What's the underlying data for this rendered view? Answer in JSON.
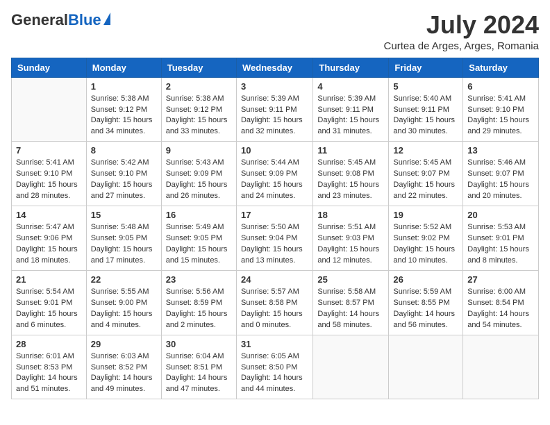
{
  "header": {
    "logo_general": "General",
    "logo_blue": "Blue",
    "month": "July 2024",
    "location": "Curtea de Arges, Arges, Romania"
  },
  "weekdays": [
    "Sunday",
    "Monday",
    "Tuesday",
    "Wednesday",
    "Thursday",
    "Friday",
    "Saturday"
  ],
  "weeks": [
    [
      {
        "day": "",
        "sunrise": "",
        "sunset": "",
        "daylight": ""
      },
      {
        "day": "1",
        "sunrise": "Sunrise: 5:38 AM",
        "sunset": "Sunset: 9:12 PM",
        "daylight": "Daylight: 15 hours and 34 minutes."
      },
      {
        "day": "2",
        "sunrise": "Sunrise: 5:38 AM",
        "sunset": "Sunset: 9:12 PM",
        "daylight": "Daylight: 15 hours and 33 minutes."
      },
      {
        "day": "3",
        "sunrise": "Sunrise: 5:39 AM",
        "sunset": "Sunset: 9:11 PM",
        "daylight": "Daylight: 15 hours and 32 minutes."
      },
      {
        "day": "4",
        "sunrise": "Sunrise: 5:39 AM",
        "sunset": "Sunset: 9:11 PM",
        "daylight": "Daylight: 15 hours and 31 minutes."
      },
      {
        "day": "5",
        "sunrise": "Sunrise: 5:40 AM",
        "sunset": "Sunset: 9:11 PM",
        "daylight": "Daylight: 15 hours and 30 minutes."
      },
      {
        "day": "6",
        "sunrise": "Sunrise: 5:41 AM",
        "sunset": "Sunset: 9:10 PM",
        "daylight": "Daylight: 15 hours and 29 minutes."
      }
    ],
    [
      {
        "day": "7",
        "sunrise": "Sunrise: 5:41 AM",
        "sunset": "Sunset: 9:10 PM",
        "daylight": "Daylight: 15 hours and 28 minutes."
      },
      {
        "day": "8",
        "sunrise": "Sunrise: 5:42 AM",
        "sunset": "Sunset: 9:10 PM",
        "daylight": "Daylight: 15 hours and 27 minutes."
      },
      {
        "day": "9",
        "sunrise": "Sunrise: 5:43 AM",
        "sunset": "Sunset: 9:09 PM",
        "daylight": "Daylight: 15 hours and 26 minutes."
      },
      {
        "day": "10",
        "sunrise": "Sunrise: 5:44 AM",
        "sunset": "Sunset: 9:09 PM",
        "daylight": "Daylight: 15 hours and 24 minutes."
      },
      {
        "day": "11",
        "sunrise": "Sunrise: 5:45 AM",
        "sunset": "Sunset: 9:08 PM",
        "daylight": "Daylight: 15 hours and 23 minutes."
      },
      {
        "day": "12",
        "sunrise": "Sunrise: 5:45 AM",
        "sunset": "Sunset: 9:07 PM",
        "daylight": "Daylight: 15 hours and 22 minutes."
      },
      {
        "day": "13",
        "sunrise": "Sunrise: 5:46 AM",
        "sunset": "Sunset: 9:07 PM",
        "daylight": "Daylight: 15 hours and 20 minutes."
      }
    ],
    [
      {
        "day": "14",
        "sunrise": "Sunrise: 5:47 AM",
        "sunset": "Sunset: 9:06 PM",
        "daylight": "Daylight: 15 hours and 18 minutes."
      },
      {
        "day": "15",
        "sunrise": "Sunrise: 5:48 AM",
        "sunset": "Sunset: 9:05 PM",
        "daylight": "Daylight: 15 hours and 17 minutes."
      },
      {
        "day": "16",
        "sunrise": "Sunrise: 5:49 AM",
        "sunset": "Sunset: 9:05 PM",
        "daylight": "Daylight: 15 hours and 15 minutes."
      },
      {
        "day": "17",
        "sunrise": "Sunrise: 5:50 AM",
        "sunset": "Sunset: 9:04 PM",
        "daylight": "Daylight: 15 hours and 13 minutes."
      },
      {
        "day": "18",
        "sunrise": "Sunrise: 5:51 AM",
        "sunset": "Sunset: 9:03 PM",
        "daylight": "Daylight: 15 hours and 12 minutes."
      },
      {
        "day": "19",
        "sunrise": "Sunrise: 5:52 AM",
        "sunset": "Sunset: 9:02 PM",
        "daylight": "Daylight: 15 hours and 10 minutes."
      },
      {
        "day": "20",
        "sunrise": "Sunrise: 5:53 AM",
        "sunset": "Sunset: 9:01 PM",
        "daylight": "Daylight: 15 hours and 8 minutes."
      }
    ],
    [
      {
        "day": "21",
        "sunrise": "Sunrise: 5:54 AM",
        "sunset": "Sunset: 9:01 PM",
        "daylight": "Daylight: 15 hours and 6 minutes."
      },
      {
        "day": "22",
        "sunrise": "Sunrise: 5:55 AM",
        "sunset": "Sunset: 9:00 PM",
        "daylight": "Daylight: 15 hours and 4 minutes."
      },
      {
        "day": "23",
        "sunrise": "Sunrise: 5:56 AM",
        "sunset": "Sunset: 8:59 PM",
        "daylight": "Daylight: 15 hours and 2 minutes."
      },
      {
        "day": "24",
        "sunrise": "Sunrise: 5:57 AM",
        "sunset": "Sunset: 8:58 PM",
        "daylight": "Daylight: 15 hours and 0 minutes."
      },
      {
        "day": "25",
        "sunrise": "Sunrise: 5:58 AM",
        "sunset": "Sunset: 8:57 PM",
        "daylight": "Daylight: 14 hours and 58 minutes."
      },
      {
        "day": "26",
        "sunrise": "Sunrise: 5:59 AM",
        "sunset": "Sunset: 8:55 PM",
        "daylight": "Daylight: 14 hours and 56 minutes."
      },
      {
        "day": "27",
        "sunrise": "Sunrise: 6:00 AM",
        "sunset": "Sunset: 8:54 PM",
        "daylight": "Daylight: 14 hours and 54 minutes."
      }
    ],
    [
      {
        "day": "28",
        "sunrise": "Sunrise: 6:01 AM",
        "sunset": "Sunset: 8:53 PM",
        "daylight": "Daylight: 14 hours and 51 minutes."
      },
      {
        "day": "29",
        "sunrise": "Sunrise: 6:03 AM",
        "sunset": "Sunset: 8:52 PM",
        "daylight": "Daylight: 14 hours and 49 minutes."
      },
      {
        "day": "30",
        "sunrise": "Sunrise: 6:04 AM",
        "sunset": "Sunset: 8:51 PM",
        "daylight": "Daylight: 14 hours and 47 minutes."
      },
      {
        "day": "31",
        "sunrise": "Sunrise: 6:05 AM",
        "sunset": "Sunset: 8:50 PM",
        "daylight": "Daylight: 14 hours and 44 minutes."
      },
      {
        "day": "",
        "sunrise": "",
        "sunset": "",
        "daylight": ""
      },
      {
        "day": "",
        "sunrise": "",
        "sunset": "",
        "daylight": ""
      },
      {
        "day": "",
        "sunrise": "",
        "sunset": "",
        "daylight": ""
      }
    ]
  ]
}
